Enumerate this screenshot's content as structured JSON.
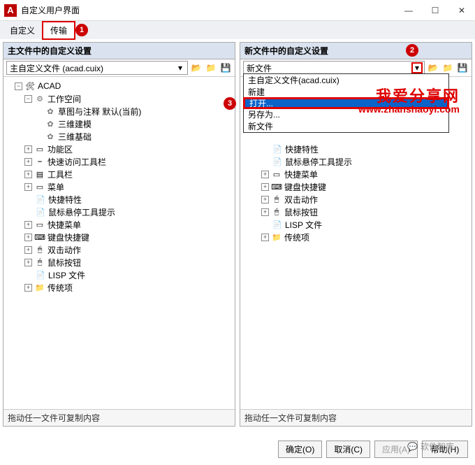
{
  "window": {
    "title": "自定义用户界面"
  },
  "tabs": {
    "t1": "自定义",
    "t2": "传输"
  },
  "callouts": {
    "c1": "1",
    "c2": "2",
    "c3": "3"
  },
  "leftPanel": {
    "header": "主文件中的自定义设置",
    "dropdown": "主自定义文件 (acad.cuix)",
    "tree": {
      "root": "ACAD",
      "workspace": "工作空间",
      "ws1": "草图与注释 默认(当前)",
      "ws2": "三维建模",
      "ws3": "三维基础",
      "n_func": "功能区",
      "n_quick": "快速访问工具栏",
      "n_toolbar": "工具栏",
      "n_menu": "菜单",
      "n_prop": "快捷特性",
      "n_hover": "鼠标悬停工具提示",
      "n_qmenu": "快捷菜单",
      "n_keys": "键盘快捷键",
      "n_dbl": "双击动作",
      "n_mouse": "鼠标按钮",
      "n_lisp": "LISP 文件",
      "n_legacy": "传统项"
    },
    "footer": "拖动任一文件可复制内容"
  },
  "rightPanel": {
    "header": "新文件中的自定义设置",
    "dropdown": "新文件",
    "ddlist": {
      "i1": "主自定义文件(acad.cuix)",
      "i2": "新建",
      "i3": "打开...",
      "i4": "另存为...",
      "i5": "新文件"
    },
    "tree": {
      "n_prop": "快捷特性",
      "n_hover": "鼠标悬停工具提示",
      "n_qmenu": "快捷菜单",
      "n_keys": "键盘快捷键",
      "n_dbl": "双击动作",
      "n_mouse": "鼠标按钮",
      "n_lisp": "LISP 文件",
      "n_legacy": "传统项"
    },
    "footer": "拖动任一文件可复制内容"
  },
  "buttons": {
    "ok": "确定(O)",
    "cancel": "取消(C)",
    "apply": "应用(A)",
    "help": "帮助(H)"
  },
  "watermark": {
    "line1": "我爱分享网",
    "line2": "www.zhanshaoyi.com",
    "wx": "软件智库"
  }
}
